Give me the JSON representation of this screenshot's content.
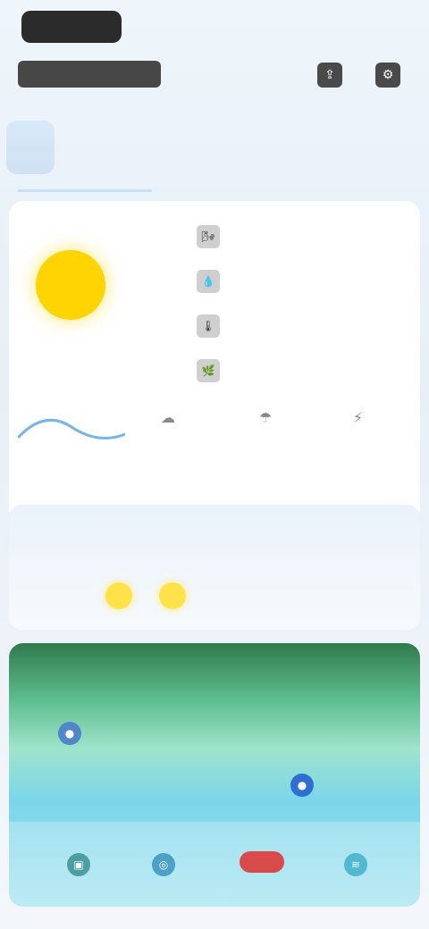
{
  "header": {
    "brand_pill": "",
    "location": "",
    "top_right": ""
  },
  "week": {
    "days": [
      "",
      "",
      "",
      "",
      "",
      "",
      ""
    ],
    "active_index": 0
  },
  "current": {
    "condition": "",
    "temp_high": "",
    "temp_low": "",
    "sunrise_sunset": "",
    "details": [
      {
        "label": "",
        "value": ""
      },
      {
        "label": "",
        "value": ""
      },
      {
        "label": "",
        "value": ""
      },
      {
        "label": "",
        "value": ""
      }
    ]
  },
  "forecast": {
    "items": [
      "",
      "",
      "",
      "",
      "",
      "",
      ""
    ]
  },
  "map": {
    "labels": [
      "",
      "",
      "",
      ""
    ],
    "bottom_tags": [
      "",
      "",
      "",
      ""
    ],
    "alert_chip": ""
  },
  "colors": {
    "sun": "#ffd400",
    "alert": "#d94a4a",
    "good": "#3a9a36"
  }
}
